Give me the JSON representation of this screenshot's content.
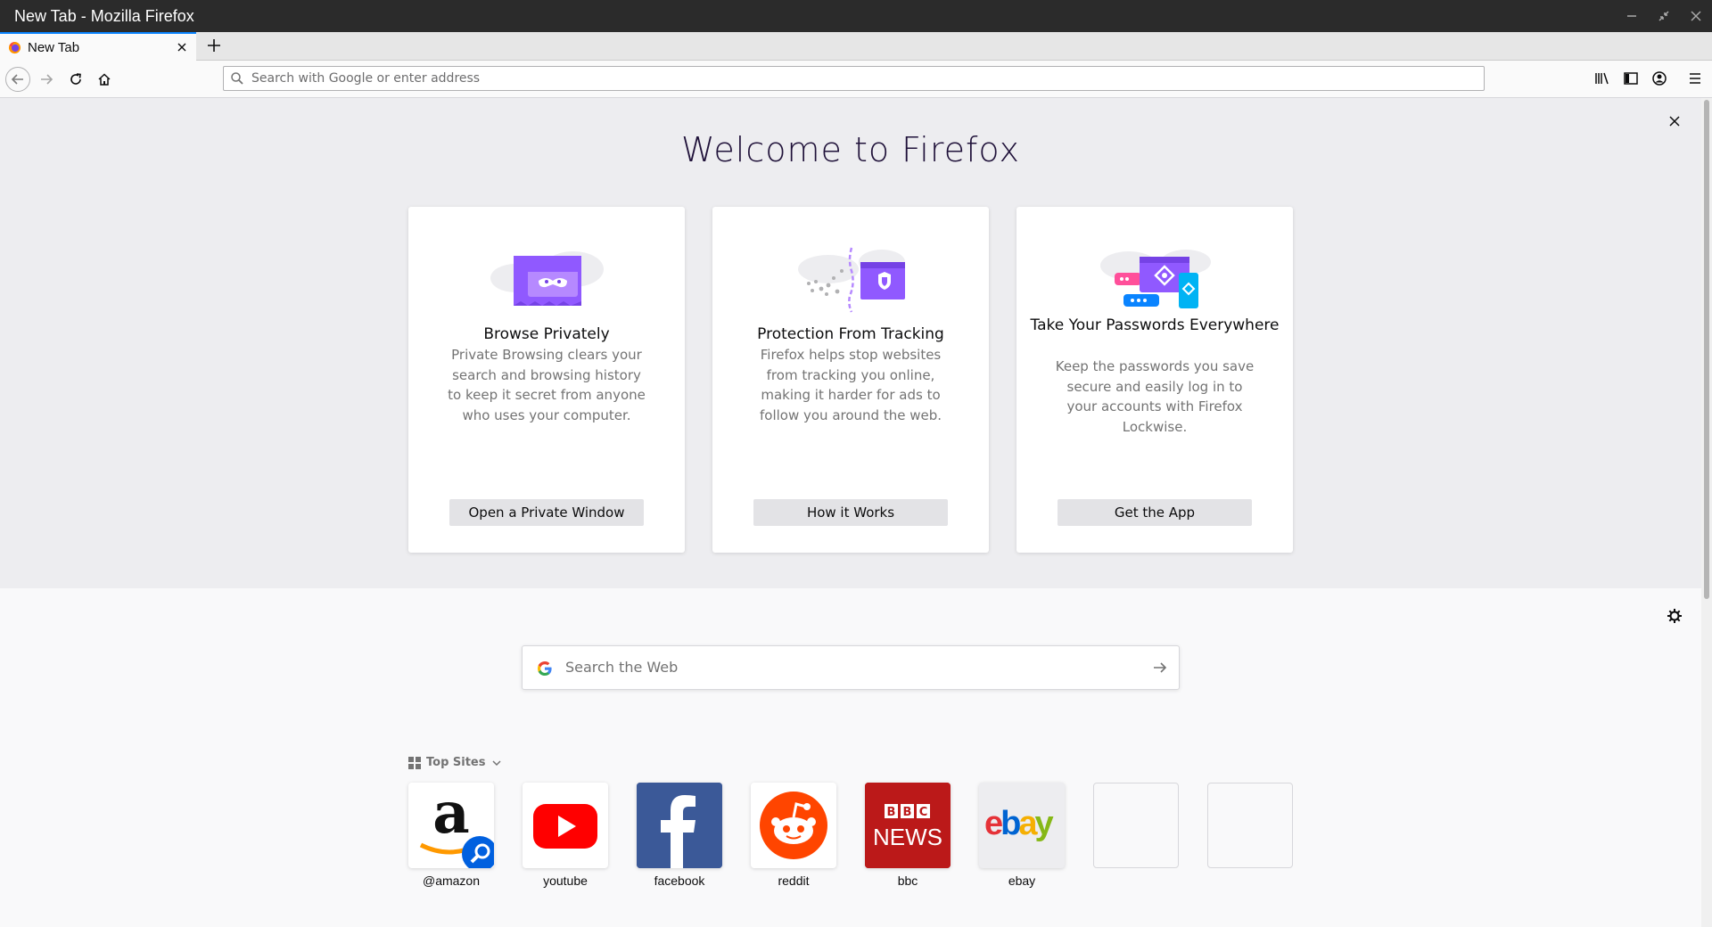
{
  "window": {
    "title": "New Tab - Mozilla Firefox"
  },
  "tabs": [
    {
      "label": "New Tab",
      "active": true
    }
  ],
  "urlbar": {
    "placeholder": "Search with Google or enter address"
  },
  "welcome": {
    "heading": "Welcome to Firefox",
    "cards": [
      {
        "title": "Browse Privately",
        "body": "Private Browsing clears your search and browsing history to keep it secret from anyone who uses your computer.",
        "button": "Open a Private Window"
      },
      {
        "title": "Protection From Tracking",
        "body": "Firefox helps stop websites from tracking you online, making it harder for ads to follow you around the web.",
        "button": "How it Works"
      },
      {
        "title": "Take Your Passwords Everywhere",
        "body": "Keep the passwords you save secure and easily log in to your accounts with Firefox Lockwise.",
        "button": "Get the App"
      }
    ]
  },
  "search": {
    "placeholder": "Search the Web"
  },
  "top_sites": {
    "label": "Top Sites",
    "sites": [
      {
        "name": "@amazon",
        "icon": "amazon-logo"
      },
      {
        "name": "youtube",
        "icon": "youtube-logo"
      },
      {
        "name": "facebook",
        "icon": "facebook-logo"
      },
      {
        "name": "reddit",
        "icon": "reddit-logo"
      },
      {
        "name": "bbc",
        "icon": "bbc-news-logo"
      },
      {
        "name": "ebay",
        "icon": "ebay-logo"
      }
    ]
  },
  "colors": {
    "accent": "#0a84ff",
    "welcome_bg": "#ededf0",
    "heading": "#20123a",
    "purple": "#9059ff"
  }
}
